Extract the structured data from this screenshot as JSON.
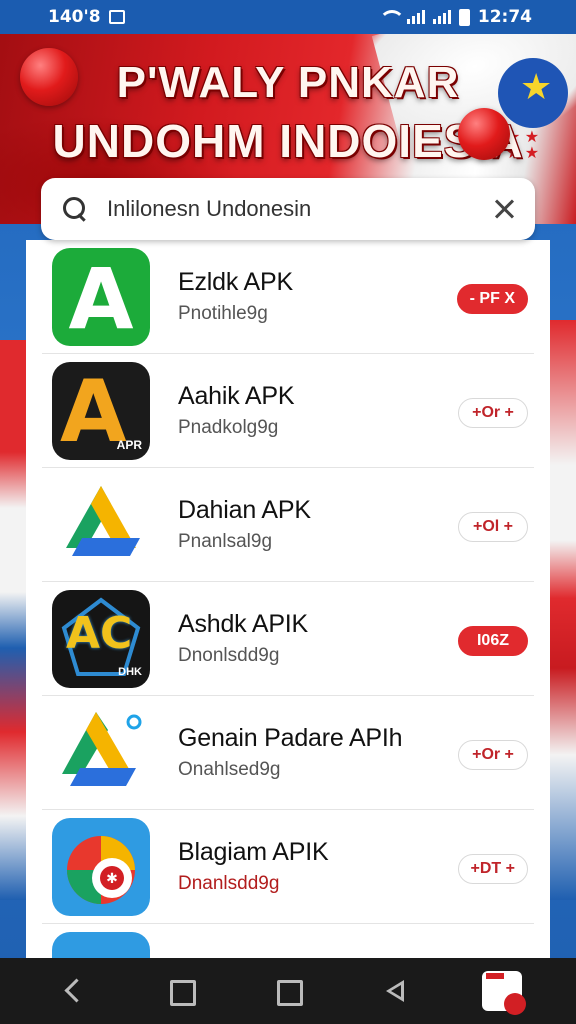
{
  "status_bar": {
    "time_left": "140'8",
    "time_right": "12:74"
  },
  "banner": {
    "title_line1": "P'WALY PNKAR",
    "title_line2": "UNDOHM  INDOIESIA"
  },
  "search": {
    "value": "Inlilonesn Undonesin"
  },
  "apps": [
    {
      "name": "Ezldk APK",
      "subtitle": "Pnotihle9g",
      "action": "- PF X",
      "action_style": "filled",
      "sub_color": "#555555"
    },
    {
      "name": "Aahik APK",
      "subtitle": "Pnadkolg9g",
      "action": "+Or +",
      "action_style": "outline",
      "sub_color": "#555555"
    },
    {
      "name": "Dahian APK",
      "subtitle": "Pnanlsal9g",
      "action": "+Ol +",
      "action_style": "outline",
      "sub_color": "#555555"
    },
    {
      "name": "Ashdk APIK",
      "subtitle": "Dnonlsdd9g",
      "action": "I06Z",
      "action_style": "filled",
      "sub_color": "#555555"
    },
    {
      "name": "Genain Padare APIh",
      "subtitle": "Onahlsed9g",
      "action": "+Or +",
      "action_style": "outline",
      "sub_color": "#555555"
    },
    {
      "name": "Blagiam APIK",
      "subtitle": "Dnanlsdd9g",
      "action": "+DT +",
      "action_style": "outline",
      "sub_color": "#b21d1d"
    }
  ],
  "icons": {
    "app1_glyph": "A",
    "app2_glyph": "A",
    "app2_tag": "APR",
    "app4_glyph": "AC",
    "app4_tag": "DHK"
  },
  "colors": {
    "accent_red": "#e12a2e",
    "banner_red": "#d21a1f",
    "page_blue": "#1e63b8"
  }
}
